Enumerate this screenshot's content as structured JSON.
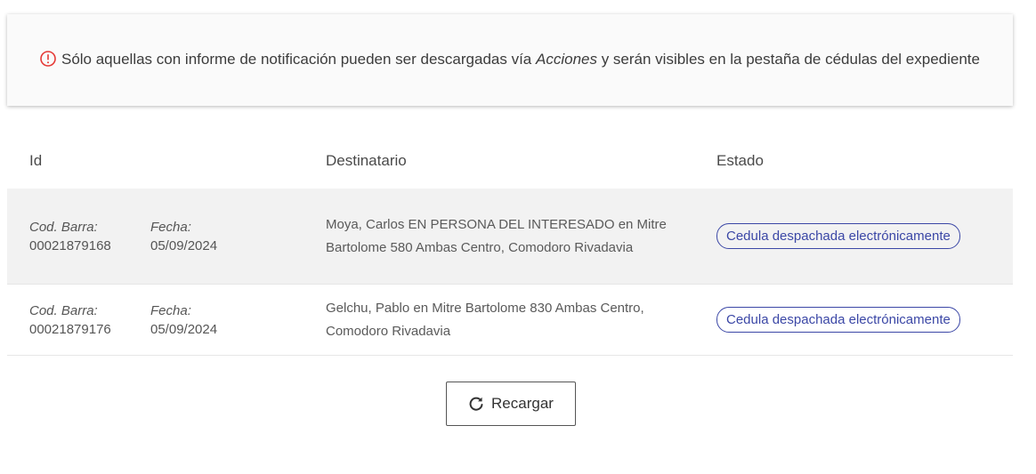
{
  "notice": {
    "text_before": "Sólo aquellas con informe de notificación pueden ser descargadas vía ",
    "emphasis": "Acciones",
    "text_after": " y serán visibles en la pestaña de cédulas del expediente",
    "icon": "alert-circle-icon",
    "icon_color": "#e53935"
  },
  "table": {
    "headers": {
      "id": "Id",
      "destinatario": "Destinatario",
      "estado": "Estado"
    },
    "rows": [
      {
        "barra_label": "Cod. Barra:",
        "barra_value": "00021879168",
        "fecha_label": "Fecha:",
        "fecha_value": "05/09/2024",
        "destinatario": "Moya, Carlos EN PERSONA DEL INTERESADO en Mitre Bartolome 580 Ambas Centro, Comodoro Rivadavia",
        "estado": "Cedula despachada electrónicamente"
      },
      {
        "barra_label": "Cod. Barra:",
        "barra_value": "00021879176",
        "fecha_label": "Fecha:",
        "fecha_value": "05/09/2024",
        "destinatario": "Gelchu, Pablo en Mitre Bartolome 830 Ambas Centro, Comodoro Rivadavia",
        "estado": "Cedula despachada electrónicamente"
      }
    ]
  },
  "reload_button": {
    "label": "Recargar",
    "icon": "refresh-icon"
  },
  "colors": {
    "badge": "#3b47a6",
    "row_shaded": "#f2f2f2"
  }
}
